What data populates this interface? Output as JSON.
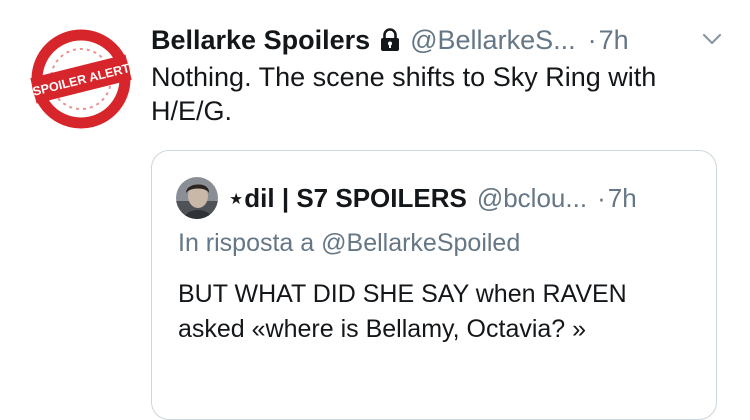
{
  "tweet": {
    "author_name": "Bellarke Spoilers",
    "author_handle": "@BellarkeS...",
    "separator": "·",
    "time": "7h",
    "text": "Nothing. The scene shifts to Sky Ring with H/E/G.",
    "avatar": {
      "text": "SPOILER ALERT",
      "accent": "#d7262b"
    },
    "icons": {
      "lock": "lock-icon",
      "caret": "chevron-down-icon"
    }
  },
  "quoted_tweet": {
    "author_name": "⋆dil | S7 SPOILERS",
    "author_handle": "@bclou...",
    "separator": "·",
    "time": "7h",
    "reply_prefix": "In risposta a",
    "reply_to": "@BellarkeSpoiled",
    "text": "BUT WHAT DID SHE SAY when RAVEN asked «where is Bellamy, Octavia? »"
  },
  "colors": {
    "text": "#14171a",
    "secondary": "#657786",
    "border": "#ccd6dd",
    "spoiler_red": "#d7262b"
  }
}
